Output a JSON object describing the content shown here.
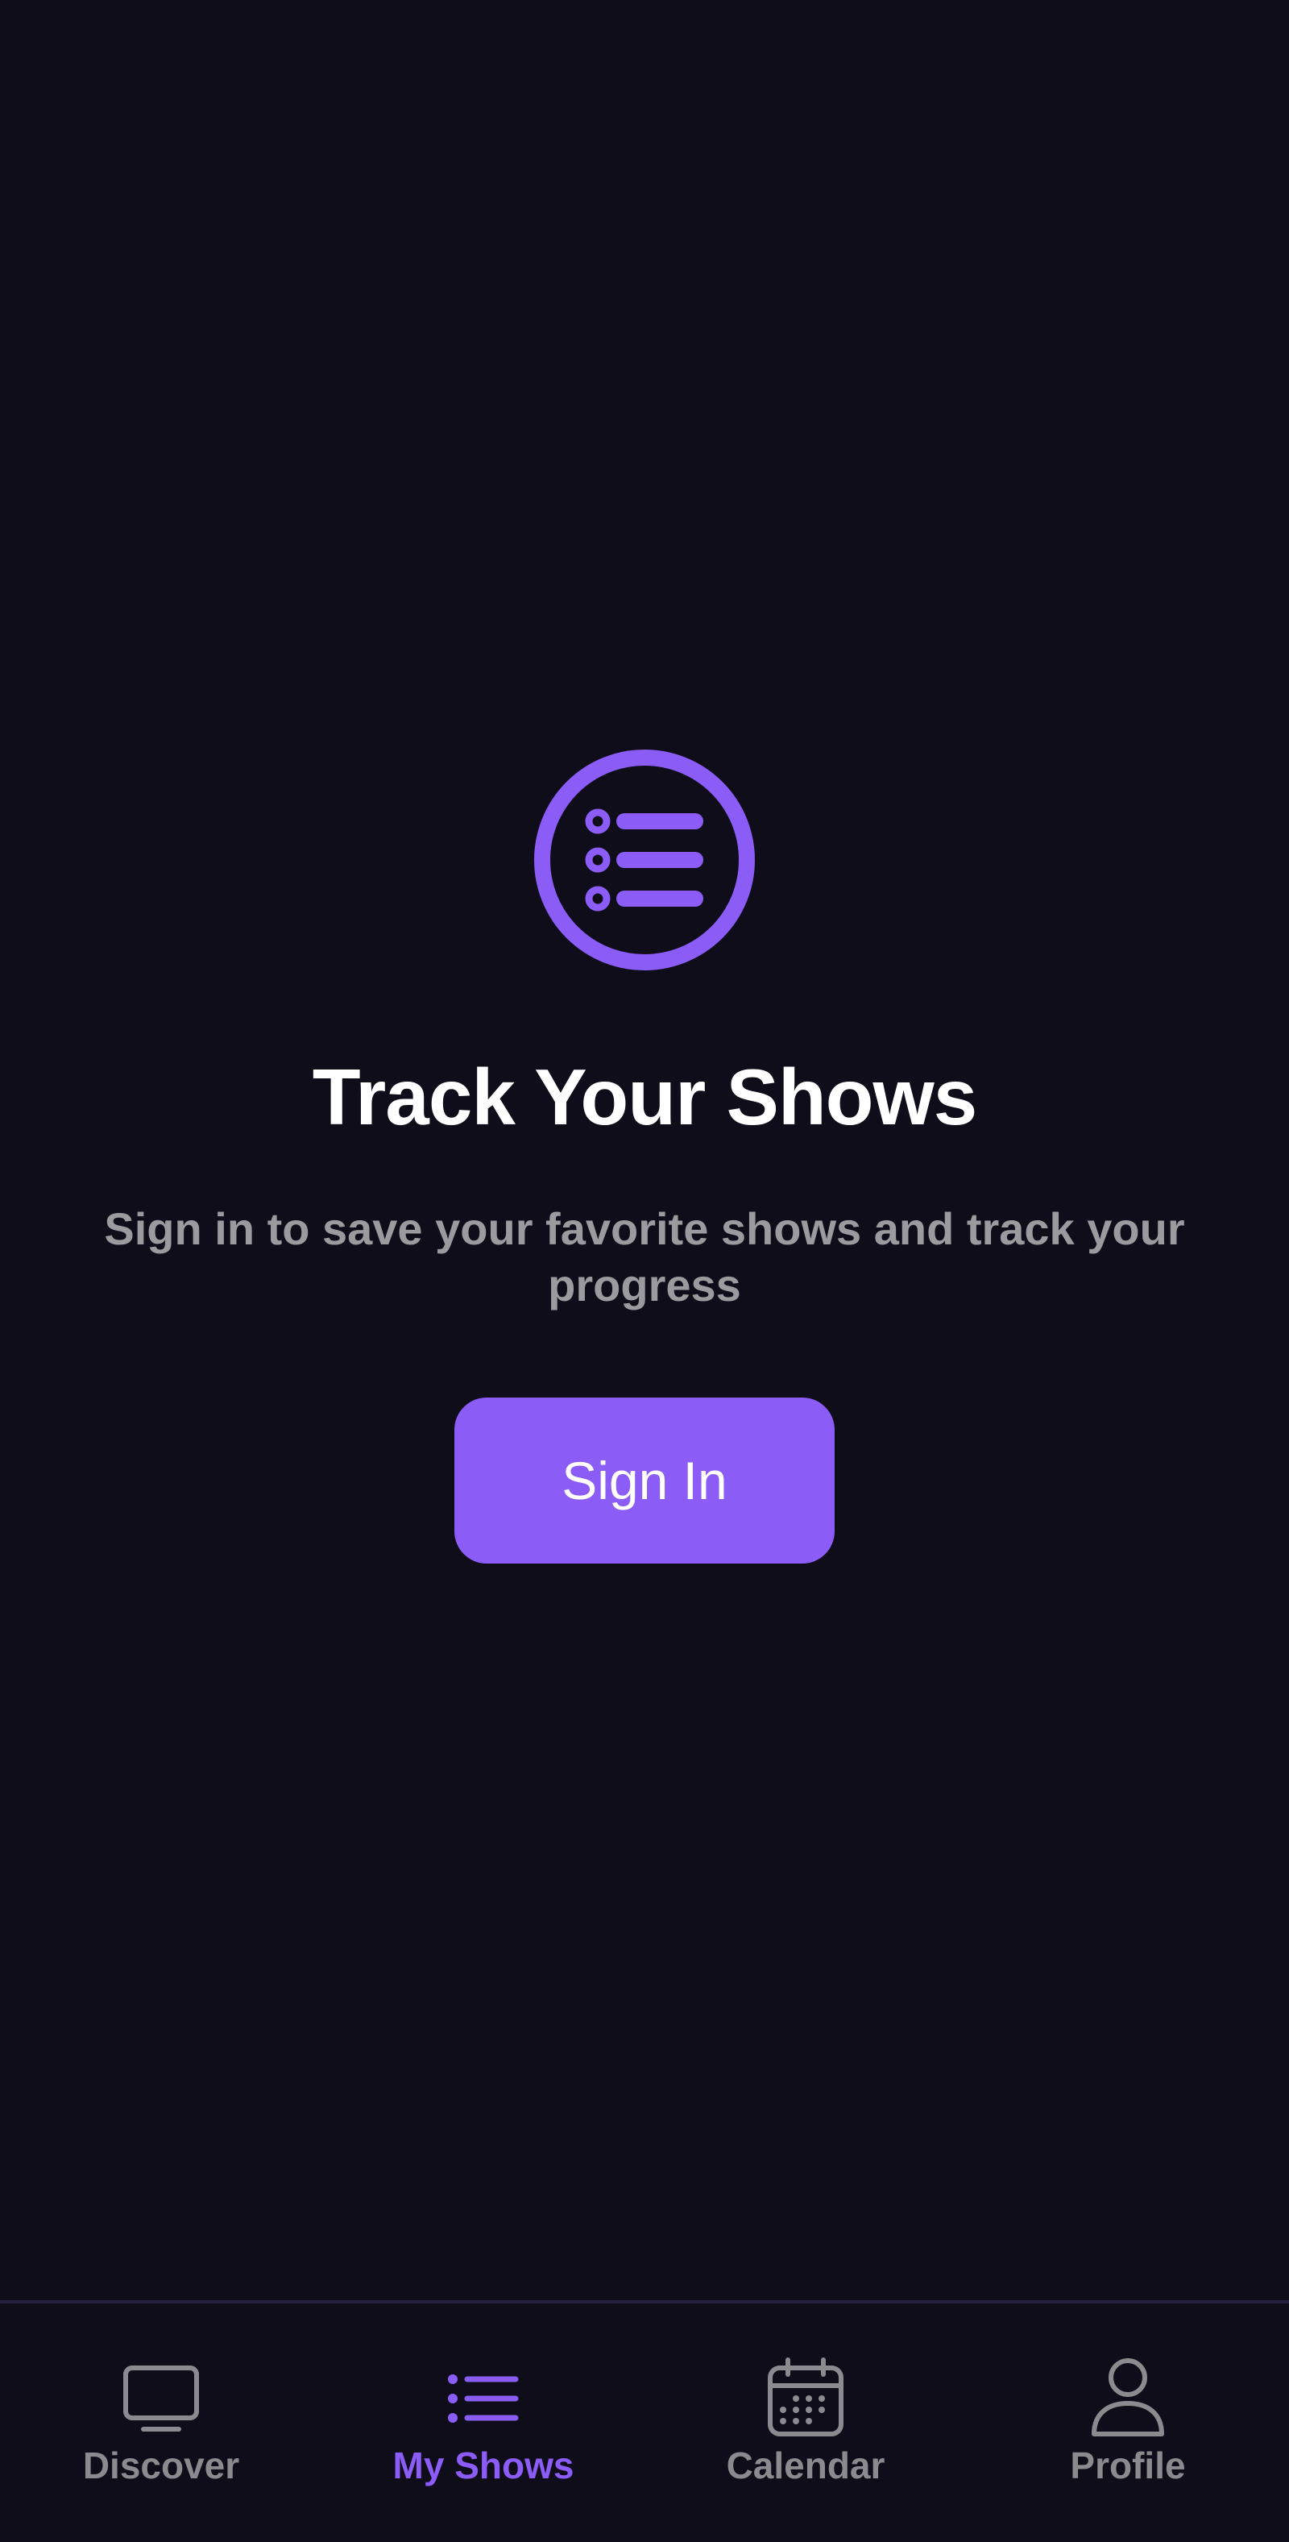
{
  "app": {
    "background": "#0f0d1a",
    "accent_color": "#8b5cf6",
    "inactive_color": "#8a8a8f"
  },
  "empty_state": {
    "icon": "list-circle-icon",
    "title": "Track Your Shows",
    "subtitle": "Sign in to save your favorite shows and track your progress",
    "button_label": "Sign In"
  },
  "tabbar": {
    "active": "my_shows",
    "tabs": [
      {
        "id": "discover",
        "label": "Discover",
        "icon": "tv-icon"
      },
      {
        "id": "my_shows",
        "label": "My Shows",
        "icon": "list-icon"
      },
      {
        "id": "calendar",
        "label": "Calendar",
        "icon": "calendar-icon"
      },
      {
        "id": "profile",
        "label": "Profile",
        "icon": "person-icon"
      }
    ]
  }
}
